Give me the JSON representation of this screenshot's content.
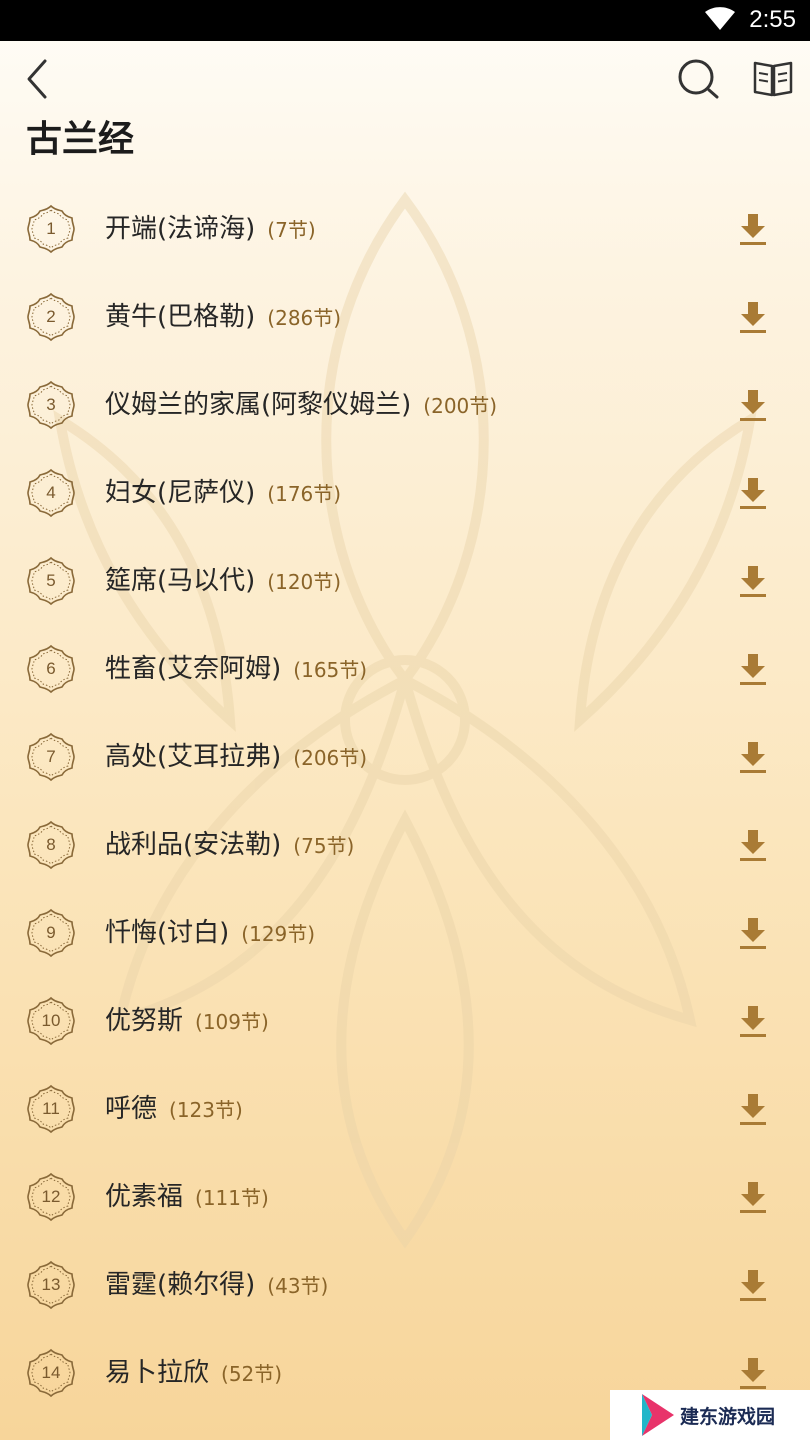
{
  "status_bar": {
    "time": "2:55"
  },
  "header": {
    "title": "古兰经"
  },
  "icons": {
    "back": "back-chevron-icon",
    "search": "search-icon",
    "book": "open-book-icon",
    "download": "download-icon"
  },
  "colors": {
    "accent": "#a97b35",
    "badge": "#8a6a3a",
    "verse_count": "#8a6429"
  },
  "surahs": [
    {
      "number": "1",
      "name": "开端(法谛海)",
      "verses": "(7节)"
    },
    {
      "number": "2",
      "name": "黄牛(巴格勒)",
      "verses": "(286节)"
    },
    {
      "number": "3",
      "name": "仪姆兰的家属(阿黎仪姆兰)",
      "verses": "(200节)"
    },
    {
      "number": "4",
      "name": "妇女(尼萨仪)",
      "verses": "(176节)"
    },
    {
      "number": "5",
      "name": "筵席(马以代)",
      "verses": "(120节)"
    },
    {
      "number": "6",
      "name": "牲畜(艾奈阿姆)",
      "verses": "(165节)"
    },
    {
      "number": "7",
      "name": "高处(艾耳拉弗)",
      "verses": "(206节)"
    },
    {
      "number": "8",
      "name": "战利品(安法勒)",
      "verses": "(75节)"
    },
    {
      "number": "9",
      "name": "忏悔(讨白)",
      "verses": "(129节)"
    },
    {
      "number": "10",
      "name": "优努斯",
      "verses": "(109节)"
    },
    {
      "number": "11",
      "name": "呼德",
      "verses": "(123节)"
    },
    {
      "number": "12",
      "name": "优素福",
      "verses": "(111节)"
    },
    {
      "number": "13",
      "name": "雷霆(赖尔得)",
      "verses": "(43节)"
    },
    {
      "number": "14",
      "name": "易卜拉欣",
      "verses": "(52节)"
    }
  ],
  "watermark": {
    "text": "建东游戏园"
  }
}
